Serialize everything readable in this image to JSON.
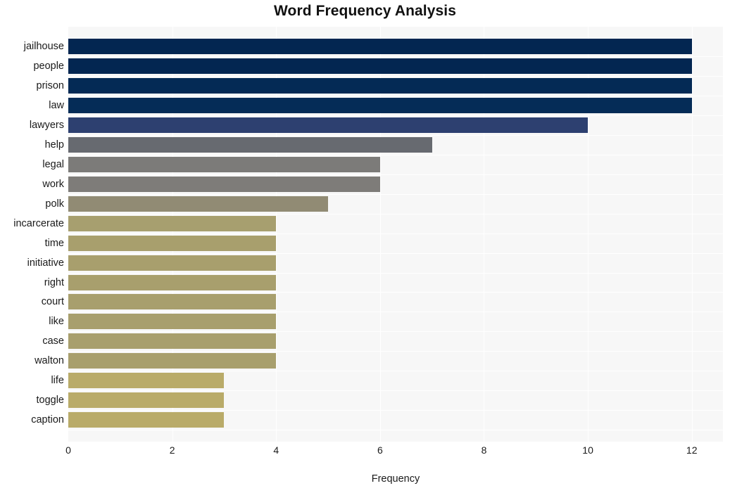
{
  "chart_data": {
    "type": "bar",
    "orientation": "horizontal",
    "title": "Word Frequency Analysis",
    "xlabel": "Frequency",
    "ylabel": "",
    "xlim": [
      0,
      12.6
    ],
    "xticks": [
      0,
      2,
      4,
      6,
      8,
      10,
      12
    ],
    "xtick_labels": [
      "0",
      "2",
      "4",
      "6",
      "8",
      "10",
      "12"
    ],
    "grid": true,
    "legend": false,
    "categories": [
      "jailhouse",
      "people",
      "prison",
      "law",
      "lawyers",
      "help",
      "legal",
      "work",
      "polk",
      "incarcerate",
      "time",
      "initiative",
      "right",
      "court",
      "like",
      "case",
      "walton",
      "life",
      "toggle",
      "caption"
    ],
    "values": [
      12,
      12,
      12,
      12,
      10,
      7,
      6,
      6,
      5,
      4,
      4,
      4,
      4,
      4,
      4,
      4,
      4,
      3,
      3,
      3
    ],
    "bar_colors": [
      "#032651",
      "#032651",
      "#042a55",
      "#052c57",
      "#2d4070",
      "#676a70",
      "#7c7b79",
      "#7e7c79",
      "#918b74",
      "#a79f6f",
      "#a89f6d",
      "#a89f6d",
      "#a89f6d",
      "#a89f6d",
      "#a89f6d",
      "#a89f6d",
      "#a89f6d",
      "#b9ab69",
      "#b9ab69",
      "#b9ab69"
    ],
    "plot_background": "#f7f7f7",
    "figure_background": "#ffffff",
    "gridline_color": "#ffffff"
  }
}
